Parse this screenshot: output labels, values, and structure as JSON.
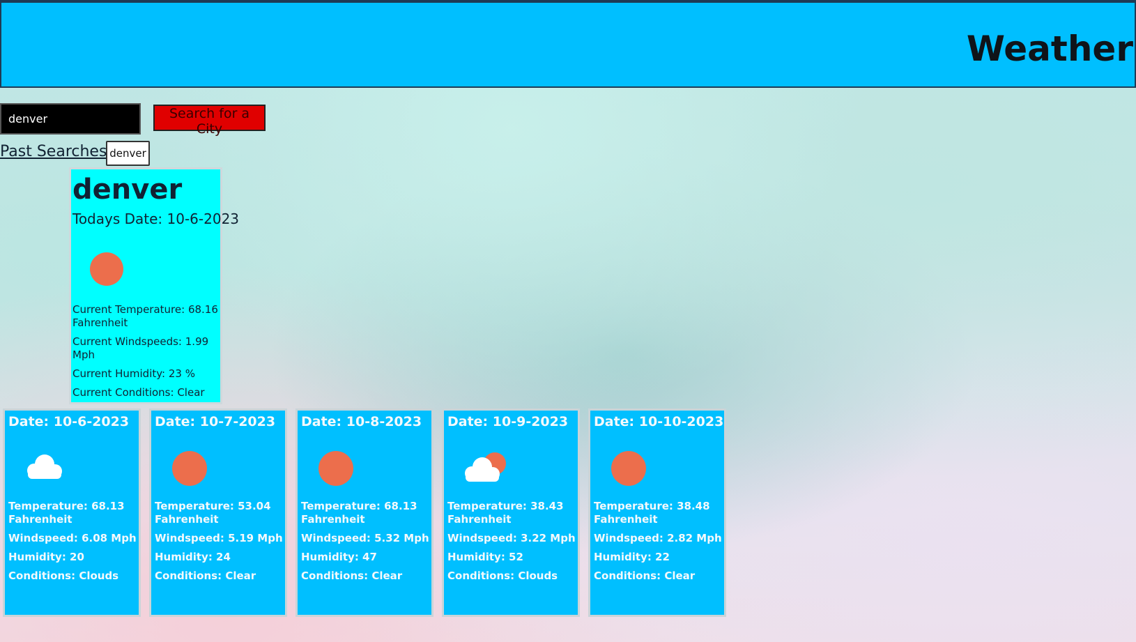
{
  "header": {
    "title": "Weather"
  },
  "search": {
    "value": "denver",
    "button_label": "Search for a City"
  },
  "past_searches": {
    "label": "Past Searches:",
    "items": [
      "denver"
    ]
  },
  "current": {
    "city": "denver",
    "date": "Todays Date: 10-6-2023",
    "icon": "sun-icon",
    "temperature": "Current Temperature: 68.16 Fahrenheit",
    "windspeed": "Current Windspeeds: 1.99 Mph",
    "humidity": "Current Humidity: 23 %",
    "conditions": "Current Conditions: Clear"
  },
  "forecast": [
    {
      "date": "Date: 10-6-2023",
      "icon": "cloud-icon",
      "temperature": "Temperature: 68.13 Fahrenheit",
      "windspeed": "Windspeed: 6.08 Mph",
      "humidity": "Humidity: 20",
      "conditions": "Conditions: Clouds"
    },
    {
      "date": "Date: 10-7-2023",
      "icon": "sun-icon",
      "temperature": "Temperature: 53.04 Fahrenheit",
      "windspeed": "Windspeed: 5.19 Mph",
      "humidity": "Humidity: 24",
      "conditions": "Conditions: Clear"
    },
    {
      "date": "Date: 10-8-2023",
      "icon": "sun-icon",
      "temperature": "Temperature: 68.13 Fahrenheit",
      "windspeed": "Windspeed: 5.32 Mph",
      "humidity": "Humidity: 47",
      "conditions": "Conditions: Clear"
    },
    {
      "date": "Date: 10-9-2023",
      "icon": "sun-behind-cloud-icon",
      "temperature": "Temperature: 38.43 Fahrenheit",
      "windspeed": "Windspeed: 3.22 Mph",
      "humidity": "Humidity: 52",
      "conditions": "Conditions: Clouds"
    },
    {
      "date": "Date: 10-10-2023",
      "icon": "sun-icon",
      "temperature": "Temperature: 38.48 Fahrenheit",
      "windspeed": "Windspeed: 2.82 Mph",
      "humidity": "Humidity: 22",
      "conditions": "Conditions: Clear"
    }
  ],
  "colors": {
    "header_bg": "#00bfff",
    "current_card_bg": "#00ffff",
    "forecast_card_bg": "#00bfff",
    "search_button_bg": "#e00000",
    "sun": "#ec6e4c"
  }
}
